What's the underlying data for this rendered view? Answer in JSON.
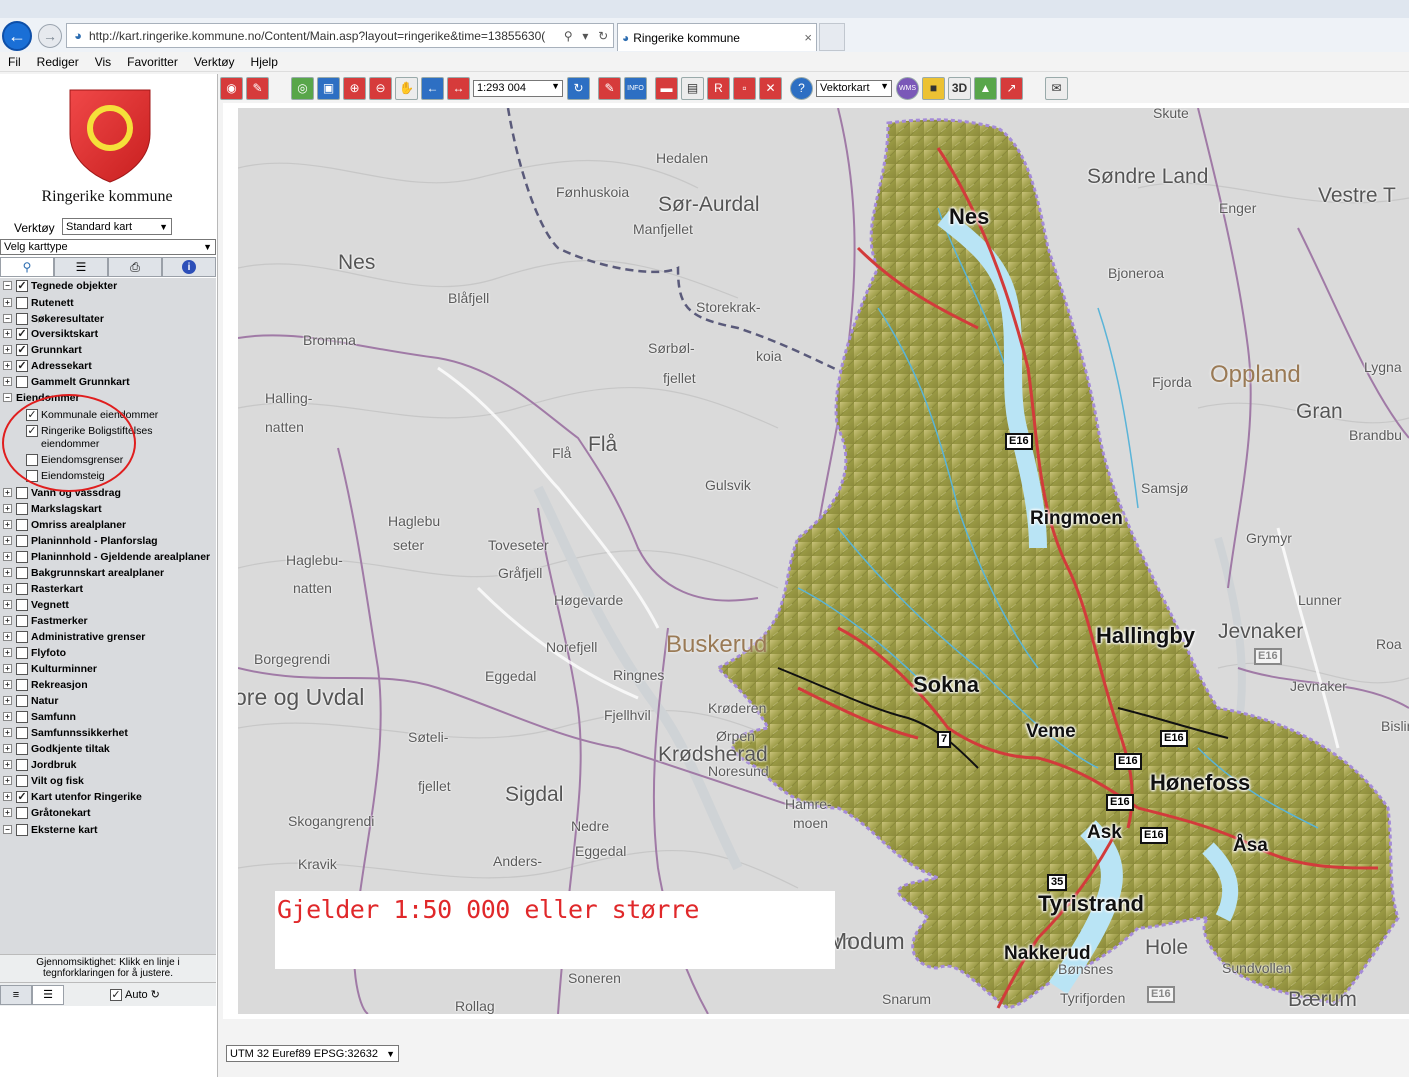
{
  "browser": {
    "url": "http://kart.ringerike.kommune.no/Content/Main.asp?layout=ringerike&time=13855630(",
    "tab_title": "Ringerike kommune",
    "tab_close": "×",
    "menu": [
      "Fil",
      "Rediger",
      "Vis",
      "Favoritter",
      "Verktøy",
      "Hjelp"
    ]
  },
  "toolbar": {
    "scale_value": "1:293 004",
    "basemap_value": "Vektorkart"
  },
  "sidebar": {
    "org_name": "Ringerike kommune",
    "verktoy_label": "Verktøy",
    "verktoy_value": "Standard kart",
    "karttype_value": "Velg karttype",
    "layers": [
      {
        "label": "Tegnede objekter",
        "checked": true,
        "expander": "−"
      },
      {
        "label": "Rutenett",
        "checked": false,
        "expander": "+"
      },
      {
        "label": "Søkeresultater",
        "checked": false,
        "expander": "−"
      },
      {
        "label": "Oversiktskart",
        "checked": true,
        "expander": "+"
      },
      {
        "label": "Grunnkart",
        "checked": true,
        "expander": "+"
      },
      {
        "label": "Adressekart",
        "checked": true,
        "expander": "+"
      },
      {
        "label": "Gammelt Grunnkart",
        "checked": false,
        "expander": "+"
      },
      {
        "label": "Eiendommer",
        "checked": null,
        "expander": "−"
      },
      {
        "label": "Kommunale eiendommer",
        "checked": true,
        "sub": true
      },
      {
        "label": "Ringerike Boligstiftelses",
        "checked": true,
        "sub": true
      },
      {
        "label": "eiendommer",
        "checked": null,
        "sub": true,
        "cont": true
      },
      {
        "label": "Eiendomsgrenser",
        "checked": false,
        "sub": true
      },
      {
        "label": "Eiendomsteig",
        "checked": false,
        "sub": true
      },
      {
        "label": "Vann og vassdrag",
        "checked": false,
        "expander": "+"
      },
      {
        "label": "Markslagskart",
        "checked": false,
        "expander": "+"
      },
      {
        "label": "Omriss arealplaner",
        "checked": false,
        "expander": "+"
      },
      {
        "label": "Planinnhold - Planforslag",
        "checked": false,
        "expander": "+"
      },
      {
        "label": "Planinnhold - Gjeldende arealplaner",
        "checked": false,
        "expander": "+"
      },
      {
        "label": "Bakgrunnskart arealplaner",
        "checked": false,
        "expander": "+"
      },
      {
        "label": "Rasterkart",
        "checked": false,
        "expander": "+"
      },
      {
        "label": "Vegnett",
        "checked": false,
        "expander": "+"
      },
      {
        "label": "Fastmerker",
        "checked": false,
        "expander": "+"
      },
      {
        "label": "Administrative grenser",
        "checked": false,
        "expander": "+"
      },
      {
        "label": "Flyfoto",
        "checked": false,
        "expander": "+"
      },
      {
        "label": "Kulturminner",
        "checked": false,
        "expander": "+"
      },
      {
        "label": "Rekreasjon",
        "checked": false,
        "expander": "+"
      },
      {
        "label": "Natur",
        "checked": false,
        "expander": "+"
      },
      {
        "label": "Samfunn",
        "checked": false,
        "expander": "+"
      },
      {
        "label": "Samfunnssikkerhet",
        "checked": false,
        "expander": "+"
      },
      {
        "label": "Godkjente tiltak",
        "checked": false,
        "expander": "+"
      },
      {
        "label": "Jordbruk",
        "checked": false,
        "expander": "+"
      },
      {
        "label": "Vilt og fisk",
        "checked": false,
        "expander": "+"
      },
      {
        "label": "Kart utenfor Ringerike",
        "checked": true,
        "expander": "+"
      },
      {
        "label": "Gråtonekart",
        "checked": false,
        "expander": "+"
      },
      {
        "label": "Eksterne kart",
        "checked": false,
        "expander": "−"
      }
    ],
    "transparency_text_1": "Gjennomsiktighet: Klikk en linje i",
    "transparency_text_2": "tegnforklaringen for å justere.",
    "auto_label": "Auto"
  },
  "map": {
    "scale_note": "Gjelder 1:50 000 eller større",
    "municipality_places": [
      "Nes",
      "Ringmoen",
      "Hallingby",
      "Sokna",
      "Veme",
      "Hønefoss",
      "Ask",
      "Åsa",
      "Tyristrand",
      "Nakkerud"
    ],
    "places": [
      "Hedalen",
      "Fønhuskoia",
      "Manfjellet",
      "Blåfjell",
      "Bromma",
      "Storekrak-",
      "koia",
      "Sørbøl-",
      "fjellet",
      "Halling-",
      "natten",
      "Flå",
      "Gulsvik",
      "Haglebu",
      "seter",
      "Haglebu-",
      "natten",
      "Toveseter",
      "Gråfjell",
      "Høgevarde",
      "Borgegrendi",
      "Norefjell",
      "Eggedal",
      "Ringnes",
      "Fjellhvil",
      "Krøderen",
      "Ørpen",
      "Noresund",
      "Søteli-",
      "fjellet",
      "Hamre-",
      "moen",
      "Skogangrendi",
      "Nedre",
      "Eggedal",
      "Anders-",
      "Kravik",
      "Modum",
      "Soneren",
      "Rollag",
      "Snarum",
      "Fjorda",
      "Samsjø",
      "Bjoneroa",
      "Enger",
      "Skute",
      "Grymyr",
      "Lunner",
      "Jevnaker",
      "Bisling",
      "Hole",
      "Sundvollen",
      "Tyrifjorden",
      "Bærum",
      "Bønsnes",
      "Brandbu",
      "Lygna",
      "Roa"
    ],
    "big_places": [
      "Sør-Aurdal",
      "Søndre Land",
      "Vestre T",
      "Nes",
      "Flå",
      "Sigdal",
      "Krødsherad",
      "Gran",
      "Jevnaker",
      "Hole",
      "Modum"
    ],
    "regions": [
      "Oppland",
      "Buskerud"
    ],
    "kommune_edge": "ore og Uvdal",
    "roads": [
      "E16",
      "E16",
      "E16",
      "E16",
      "E16",
      "7",
      "35"
    ],
    "grey_roads": [
      "E16",
      "E16"
    ]
  },
  "footer": {
    "projection_value": "UTM 32 Euref89 EPSG:32632"
  }
}
